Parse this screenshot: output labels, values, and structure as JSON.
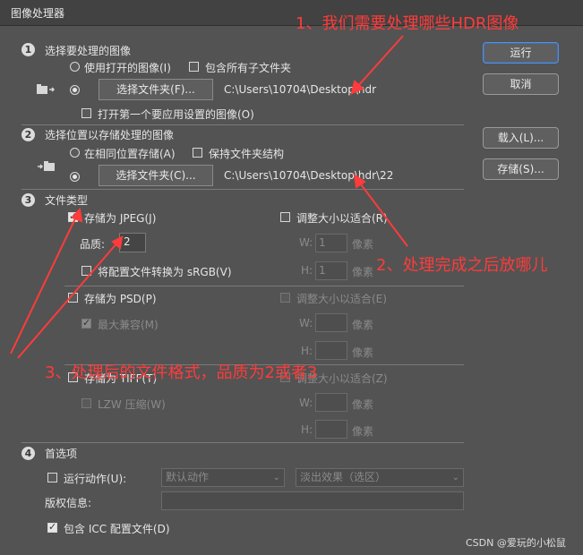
{
  "window": {
    "title": "图像处理器"
  },
  "section1": {
    "number": "1",
    "heading": "选择要处理的图像",
    "use_open_images": "使用打开的图像(I)",
    "include_subfolders": "包含所有子文件夹",
    "select_folder_btn": "选择文件夹(F)...",
    "folder_path": "C:\\Users\\10704\\Desktop\\hdr",
    "open_first_image": "打开第一个要应用设置的图像(O)"
  },
  "section2": {
    "number": "2",
    "heading": "选择位置以存储处理的图像",
    "save_same_location": "在相同位置存储(A)",
    "keep_folder_structure": "保持文件夹结构",
    "select_folder_btn": "选择文件夹(C)...",
    "folder_path": "C:\\Users\\10704\\Desktop\\hdr\\22"
  },
  "section3": {
    "number": "3",
    "heading": "文件类型",
    "save_jpeg": "存储为 JPEG(J)",
    "resize_fit_1": "调整大小以适合(R)",
    "quality_label": "品质:",
    "quality_value": "2",
    "w_label": "W:",
    "w_value": "1",
    "h_label": "H:",
    "h_value": "1",
    "pixels": "像素",
    "convert_srgb": "将配置文件转换为 sRGB(V)",
    "save_psd": "存储为 PSD(P)",
    "resize_fit_2": "调整大小以适合(E)",
    "max_compat": "最大兼容(M)",
    "save_tiff": "存储为 TIFF(T)",
    "resize_fit_3": "调整大小以适合(Z)",
    "lzw": "LZW 压缩(W)"
  },
  "section4": {
    "number": "4",
    "heading": "首选项",
    "run_action": "运行动作(U):",
    "action_set": "默认动作",
    "action_name": "淡出效果（选区）",
    "copyright_label": "版权信息:",
    "copyright_value": "",
    "include_icc": "包含 ICC 配置文件(D)"
  },
  "buttons": {
    "run": "运行",
    "cancel": "取消",
    "load": "载入(L)...",
    "save": "存储(S)..."
  },
  "annotations": {
    "note1": "1、我们需要处理哪些HDR图像",
    "note2": "2、处理完成之后放哪儿",
    "note3": "3、处理后的文件格式，品质为2或者3"
  },
  "watermark": "CSDN @爱玩的小松鼠",
  "colors": {
    "annotation": "#ff3b3b",
    "primary_button_border": "#5b8fd6",
    "dialog_bg": "#535353"
  }
}
